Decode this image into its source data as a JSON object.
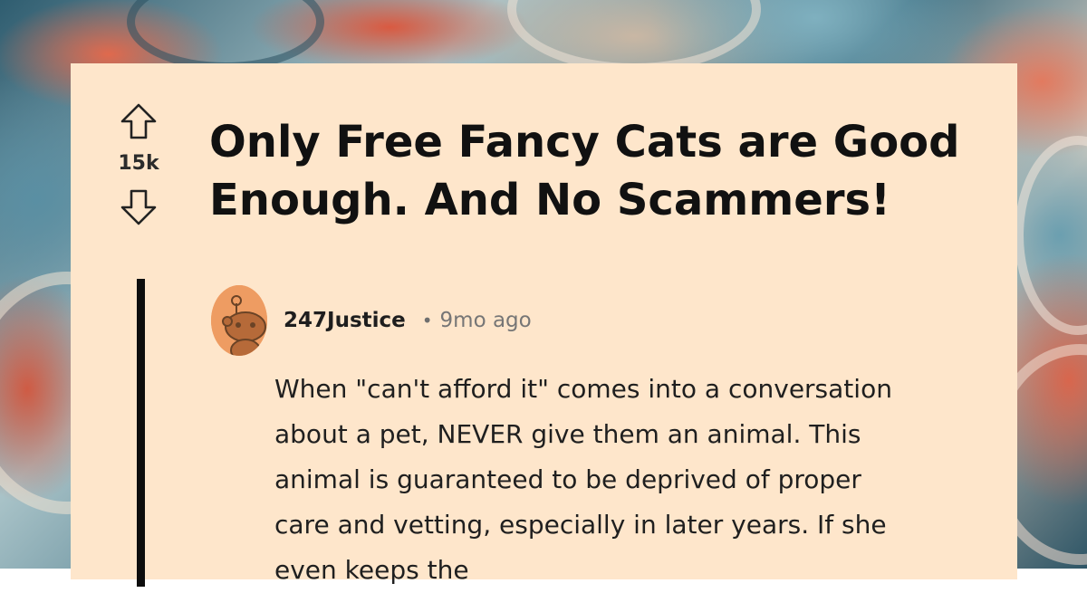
{
  "post": {
    "title": "Only Free Fancy Cats are Good Enough. And No Scammers!",
    "score": "15k",
    "icons": {
      "upvote": "upvote-arrow-icon",
      "downvote": "downvote-arrow-icon"
    }
  },
  "comment": {
    "username": "247Justice",
    "separator": "•",
    "timestamp": "9mo ago",
    "avatar": "reddit-snoo-avatar",
    "avatar_color": "#ee9c62",
    "body": "When \"can't afford it\" comes into a conversation about a pet, NEVER give them an animal. This animal is guaranteed to be deprived of proper care and vetting, especially in later years. If she even keeps the"
  },
  "colors": {
    "card_background": "#fee6cb",
    "thread_line": "#0d0d0d"
  }
}
